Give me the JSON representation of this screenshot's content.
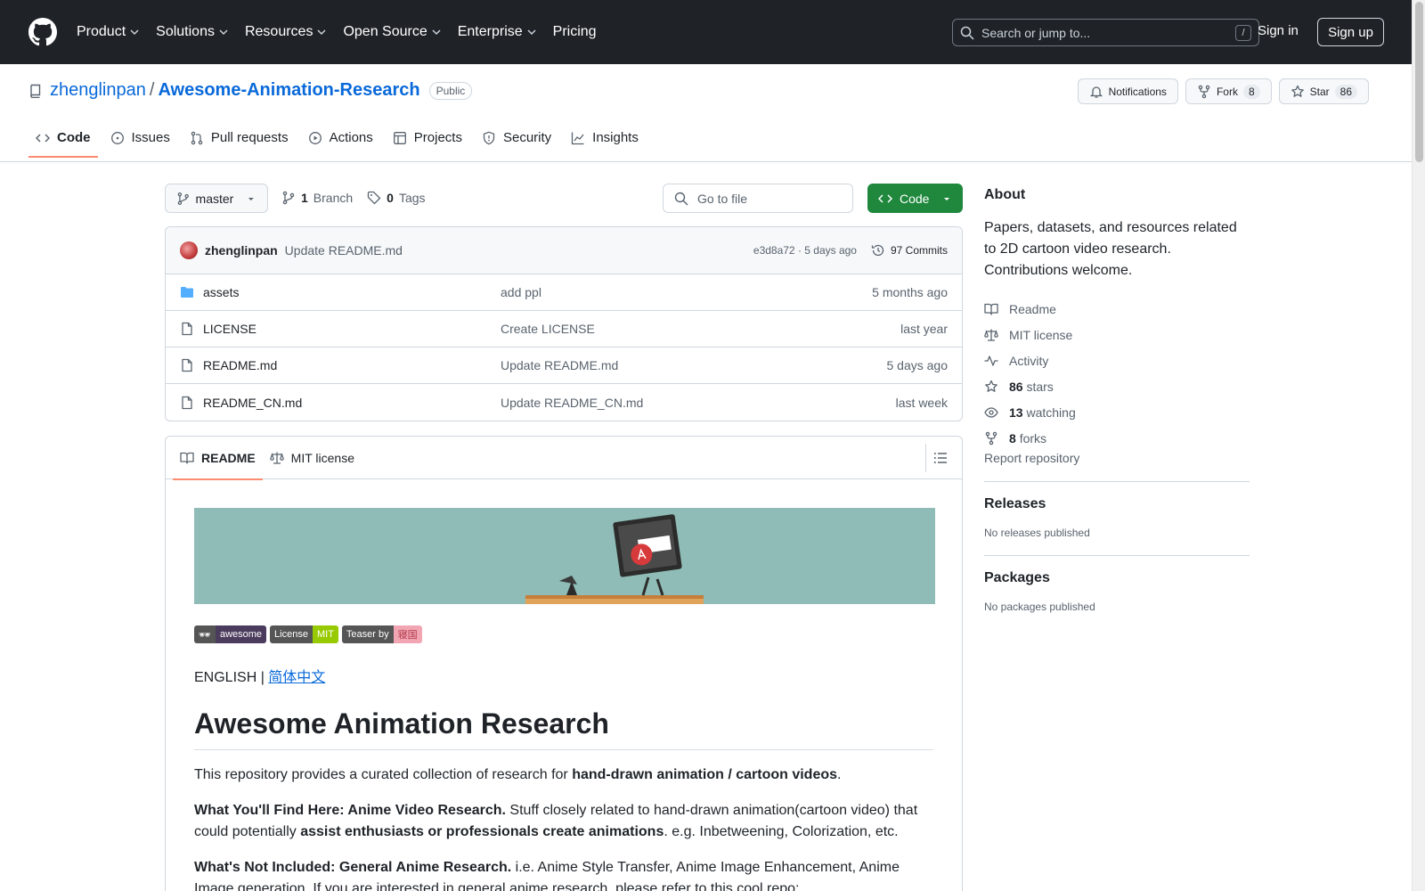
{
  "topnav": {
    "items": [
      "Product",
      "Solutions",
      "Resources",
      "Open Source",
      "Enterprise",
      "Pricing"
    ],
    "search_placeholder": "Search or jump to...",
    "search_shortcut": "/",
    "sign_in": "Sign in",
    "sign_up": "Sign up"
  },
  "repo": {
    "owner": "zhenglinpan",
    "separator": "/",
    "name": "Awesome-Animation-Research",
    "visibility": "Public",
    "notifications_label": "Notifications",
    "fork_label": "Fork",
    "fork_count": "8",
    "star_label": "Star",
    "star_count": "86"
  },
  "tabs": [
    "Code",
    "Issues",
    "Pull requests",
    "Actions",
    "Projects",
    "Security",
    "Insights"
  ],
  "branch": {
    "name": "master",
    "branch_count": "1",
    "branch_label": "Branch",
    "tag_count": "0",
    "tag_label": "Tags",
    "goto_placeholder": "Go to file",
    "code_label": "Code"
  },
  "commit": {
    "author": "zhenglinpan",
    "message": "Update README.md",
    "hash_time": "e3d8a72 · 5 days ago",
    "commits_label": "97 Commits"
  },
  "files": [
    {
      "name": "assets",
      "type": "folder",
      "message": "add ppl",
      "date": "5 months ago"
    },
    {
      "name": "LICENSE",
      "type": "file",
      "message": "Create LICENSE",
      "date": "last year"
    },
    {
      "name": "README.md",
      "type": "file",
      "message": "Update README.md",
      "date": "5 days ago"
    },
    {
      "name": "README_CN.md",
      "type": "file",
      "message": "Update README_CN.md",
      "date": "last week"
    }
  ],
  "readme": {
    "tab_readme": "README",
    "tab_license": "MIT license",
    "badges": [
      {
        "left": "🕶",
        "right": "awesome",
        "left_color": "#555555",
        "right_color": "#4b3b5c"
      },
      {
        "left": "License",
        "right": "MIT",
        "left_color": "#555555",
        "right_color": "#97ca00"
      },
      {
        "left": "Teaser by",
        "right": "寝国",
        "left_color": "#555555",
        "right_color": "#f2a6b3"
      }
    ],
    "lang_prefix": "ENGLISH | ",
    "lang_link": "简体中文",
    "title": "Awesome Animation Research",
    "p1_a": "This repository provides a curated collection of research for ",
    "p1_b": "hand-drawn animation / ",
    "p1_c": "cartoon videos",
    "p1_d": ".",
    "p2_a": "What You'll Find Here: Anime Video Research.",
    "p2_b": " Stuff closely related to hand-drawn animation(cartoon video) that could potentially ",
    "p2_c": "assist enthusiasts or professionals create animations",
    "p2_d": ". e.g. Inbetweening, Colorization, etc.",
    "p3_a": "What's Not Included: General Anime Research.",
    "p3_b": " i.e. Anime Style Transfer, Anime Image Enhancement, Anime Image generation. If you are interested in general anime research, please refer to this cool repo: "
  },
  "about": {
    "title": "About",
    "description": "Papers, datasets, and resources related to 2D cartoon video research. Contributions welcome.",
    "readme": "Readme",
    "license": "MIT license",
    "activity": "Activity",
    "stars_count": "86",
    "stars_label": "stars",
    "watching_count": "13",
    "watching_label": "watching",
    "forks_count": "8",
    "forks_label": "forks",
    "report": "Report repository"
  },
  "releases": {
    "title": "Releases",
    "empty": "No releases published"
  },
  "packages": {
    "title": "Packages",
    "empty": "No packages published"
  },
  "colors": {
    "accent": "#0969da",
    "header_bg": "#1f2328",
    "primary_button": "#1f883d",
    "tab_underline": "#fd8c73"
  }
}
